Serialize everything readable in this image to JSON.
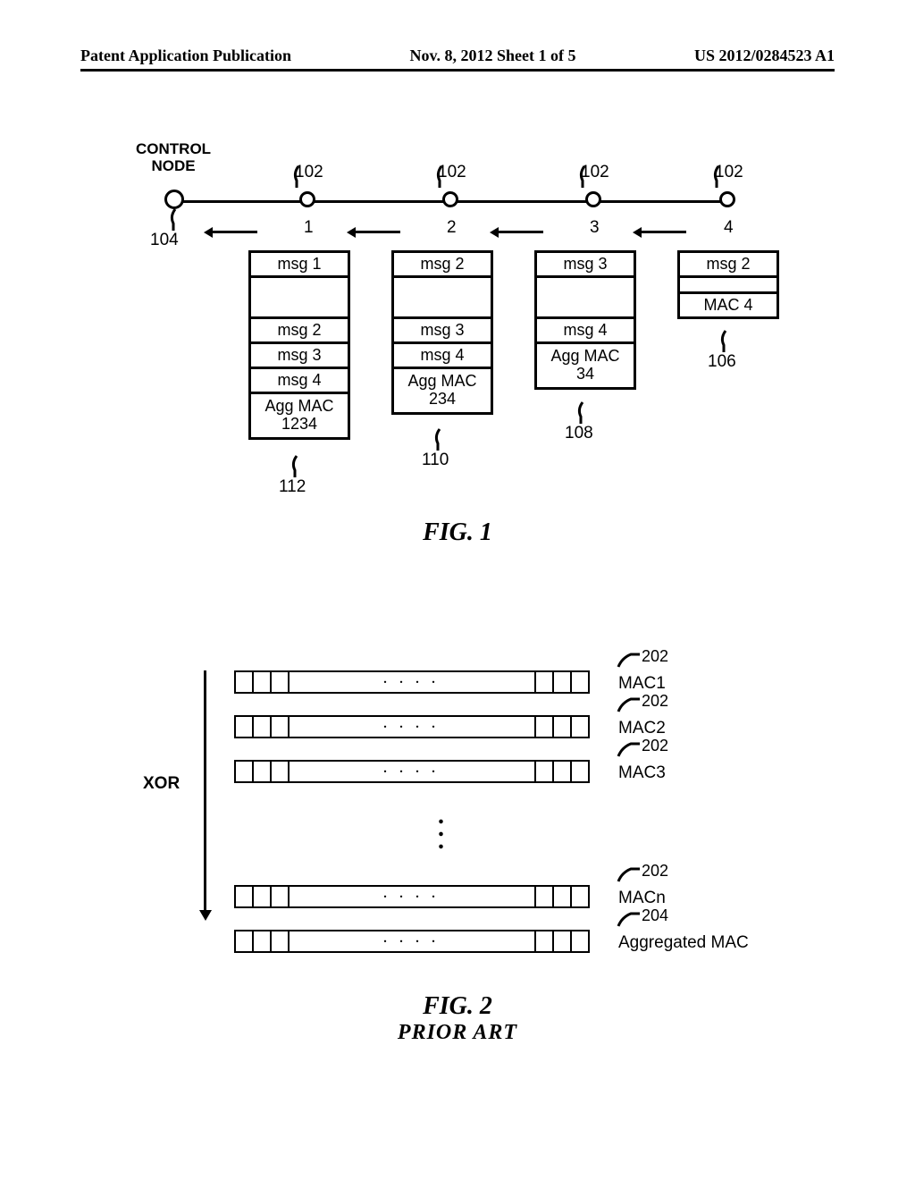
{
  "header": {
    "left": "Patent Application Publication",
    "center": "Nov. 8, 2012  Sheet 1 of 5",
    "right": "US 2012/0284523 A1"
  },
  "fig1": {
    "control_label_l1": "CONTROL",
    "control_label_l2": "NODE",
    "ref_104": "104",
    "ref_102": "102",
    "node1": "1",
    "node2": "2",
    "node3": "3",
    "node4": "4",
    "col1": {
      "r1": "msg 1",
      "r2": "msg 2",
      "r3": "msg 3",
      "r4": "msg 4",
      "r5a": "Agg MAC",
      "r5b": "1234"
    },
    "col2": {
      "r1": "msg 2",
      "r2": "msg 3",
      "r3": "msg 4",
      "r4a": "Agg MAC",
      "r4b": "234"
    },
    "col3": {
      "r1": "msg 3",
      "r2": "msg 4",
      "r3a": "Agg MAC",
      "r3b": "34"
    },
    "col4": {
      "r1": "msg 2",
      "r2": "MAC 4"
    },
    "ref_106": "106",
    "ref_108": "108",
    "ref_110": "110",
    "ref_112": "112",
    "caption": "FIG.  1"
  },
  "fig2": {
    "xor": "XOR",
    "mac1": "MAC1",
    "mac2": "MAC2",
    "mac3": "MAC3",
    "macn": "MACn",
    "agg": "Aggregated MAC",
    "ref202": "202",
    "ref204": "204",
    "caption": "FIG.  2",
    "prior": "PRIOR  ART"
  },
  "chart_data": [
    {
      "type": "table",
      "title": "FIG. 1 — message aggregation at each hop",
      "columns": [
        "hop_node",
        "message_stack"
      ],
      "rows": [
        [
          "4",
          [
            "msg 2",
            "MAC 4"
          ]
        ],
        [
          "3",
          [
            "msg 3",
            "msg 4",
            "Agg MAC 34"
          ]
        ],
        [
          "2",
          [
            "msg 2",
            "msg 3",
            "msg 4",
            "Agg MAC 234"
          ]
        ],
        [
          "1",
          [
            "msg 1",
            "msg 2",
            "msg 3",
            "msg 4",
            "Agg MAC 1234"
          ]
        ]
      ],
      "refs": {
        "nodes": 102,
        "control_node": 104,
        "packet_4": 106,
        "packet_3": 108,
        "packet_2": 110,
        "packet_1": 112
      }
    },
    {
      "type": "table",
      "title": "FIG. 2 (PRIOR ART) — XOR of MAC1..MACn yields Aggregated MAC",
      "operation": "XOR",
      "inputs": [
        "MAC1",
        "MAC2",
        "MAC3",
        "...",
        "MACn"
      ],
      "output": "Aggregated MAC",
      "refs": {
        "mac_i": 202,
        "aggregated": 204
      }
    }
  ]
}
